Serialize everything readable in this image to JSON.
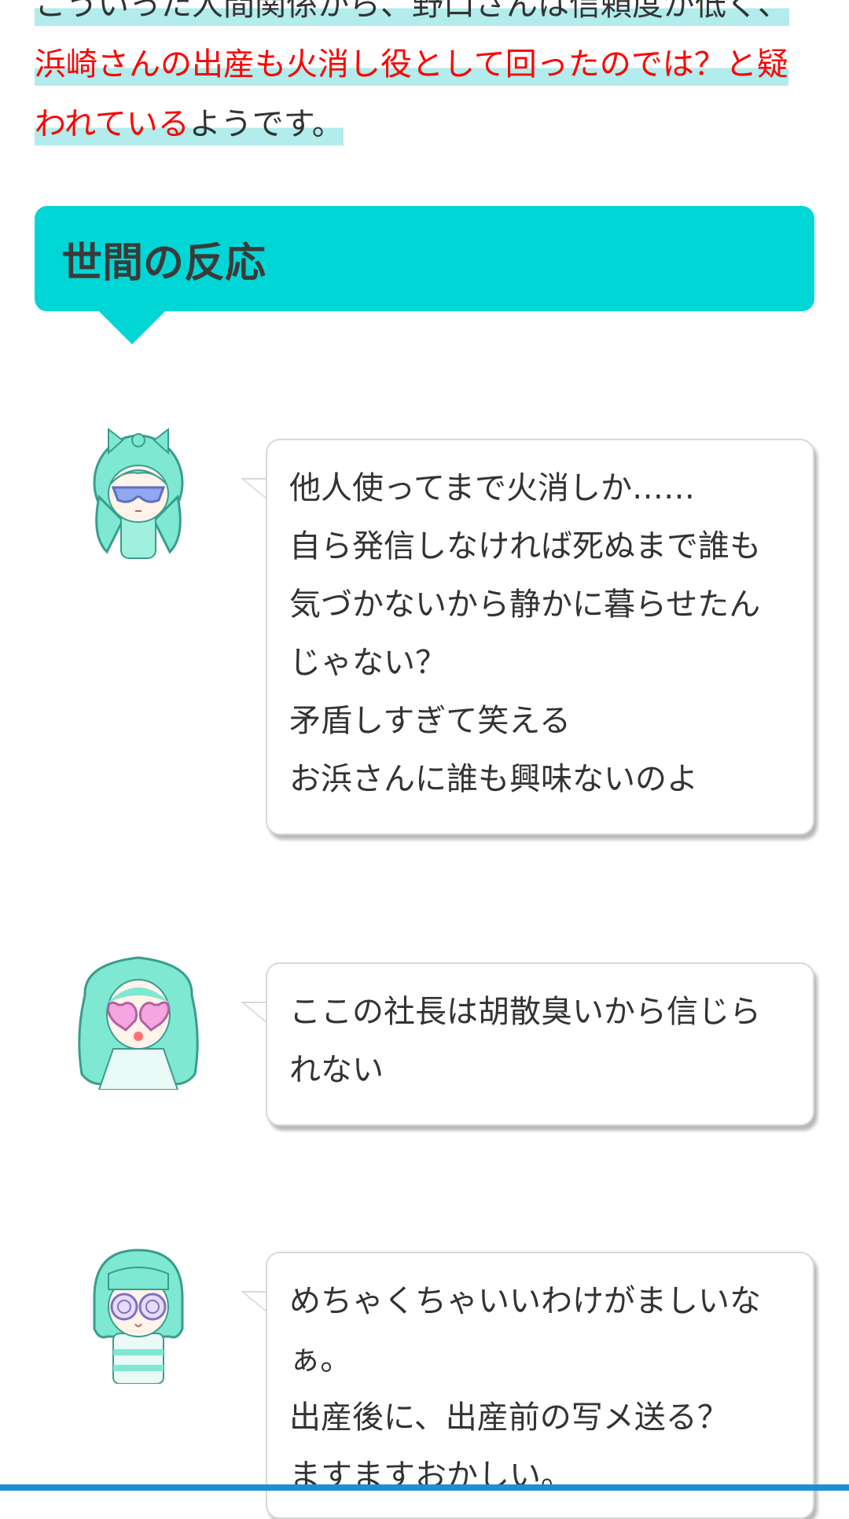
{
  "intro": {
    "line1": "こういった人間関係から、野口さんは信頼度が低く、",
    "line2_red": "浜崎さんの出産も火消し役として回ったのでは？と疑われている",
    "line2_end": "ようです。"
  },
  "section": {
    "heading": "世間の反応"
  },
  "comments": [
    {
      "avatar": "girl-bow-sunglasses-avatar",
      "text": "他人使ってまで火消しか……\n自ら発信しなければ死ぬまで誰も\n気づかないから静かに暮らせたん\nじゃない？\n矛盾しすぎて笑える\nお浜さんに誰も興味ないのよ"
    },
    {
      "avatar": "girl-heart-glasses-avatar",
      "text": "ここの社長は胡散臭いから信じら\nれない"
    },
    {
      "avatar": "girl-swirl-glasses-avatar",
      "text": "めちゃくちゃいいわけがましいな\nぁ。\n出産後に、出産前の写メ送る？\nますますおかしい。"
    }
  ],
  "colors": {
    "accent": "#00d6d6",
    "highlight": "#b2ecec",
    "emphasis": "#ff0000",
    "hair": "#7ee8d2"
  }
}
